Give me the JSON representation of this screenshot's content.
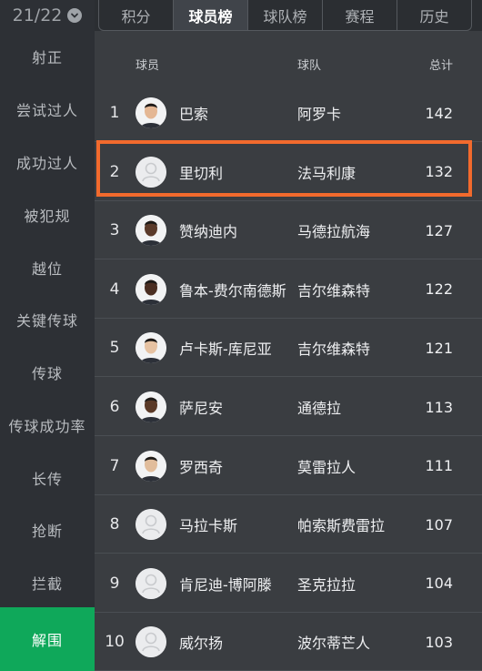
{
  "season": {
    "label": "21/22"
  },
  "tabs": [
    {
      "label": "积分"
    },
    {
      "label": "球员榜"
    },
    {
      "label": "球队榜"
    },
    {
      "label": "赛程"
    },
    {
      "label": "历史"
    }
  ],
  "active_tab": "球员榜",
  "sidebar": {
    "items": [
      {
        "label": "射正"
      },
      {
        "label": "尝试过人"
      },
      {
        "label": "成功过人"
      },
      {
        "label": "被犯规"
      },
      {
        "label": "越位"
      },
      {
        "label": "关键传球"
      },
      {
        "label": "传球"
      },
      {
        "label": "传球成功率"
      },
      {
        "label": "长传"
      },
      {
        "label": "抢断"
      },
      {
        "label": "拦截"
      },
      {
        "label": "解围"
      }
    ],
    "active": "解围"
  },
  "table": {
    "headers": {
      "player": "球员",
      "team": "球队",
      "total": "总计"
    },
    "rows": [
      {
        "rank": "1",
        "player": "巴索",
        "team": "阿罗卡",
        "total": "142",
        "avatar": "photo"
      },
      {
        "rank": "2",
        "player": "里切利",
        "team": "法马利康",
        "total": "132",
        "avatar": "placeholder"
      },
      {
        "rank": "3",
        "player": "赞纳迪内",
        "team": "马德拉航海",
        "total": "127",
        "avatar": "photo"
      },
      {
        "rank": "4",
        "player": "鲁本-费尔南德斯",
        "team": "吉尔维森特",
        "total": "122",
        "avatar": "photo"
      },
      {
        "rank": "5",
        "player": "卢卡斯-库尼亚",
        "team": "吉尔维森特",
        "total": "121",
        "avatar": "photo"
      },
      {
        "rank": "6",
        "player": "萨尼安",
        "team": "通德拉",
        "total": "113",
        "avatar": "photo"
      },
      {
        "rank": "7",
        "player": "罗西奇",
        "team": "莫雷拉人",
        "total": "111",
        "avatar": "photo"
      },
      {
        "rank": "8",
        "player": "马拉卡斯",
        "team": "帕索斯费雷拉",
        "total": "107",
        "avatar": "placeholder"
      },
      {
        "rank": "9",
        "player": "肯尼迪-博阿滕",
        "team": "圣克拉拉",
        "total": "104",
        "avatar": "placeholder"
      },
      {
        "rank": "10",
        "player": "威尔扬",
        "team": "波尔蒂芒人",
        "total": "103",
        "avatar": "placeholder"
      }
    ],
    "highlighted_rank": "2"
  },
  "colors": {
    "accent_green": "#0fa85a",
    "highlight_orange": "#f26a2d"
  }
}
